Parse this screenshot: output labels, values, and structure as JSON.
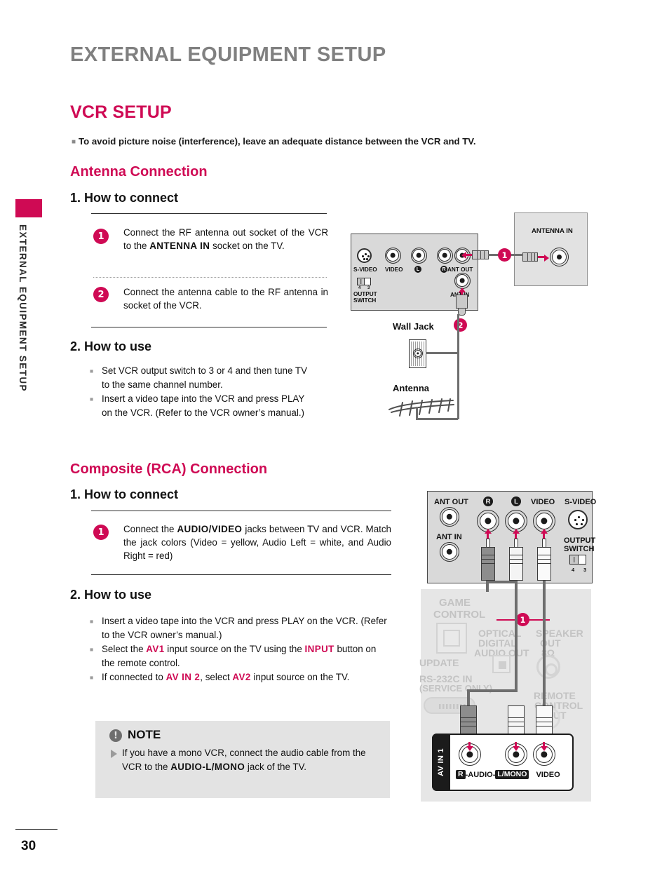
{
  "document": {
    "header_title": "EXTERNAL EQUIPMENT SETUP",
    "side_tab_label": "EXTERNAL EQUIPMENT SETUP",
    "page_number": "30"
  },
  "section": {
    "title": "VCR SETUP",
    "lede": "To avoid picture noise (interference), leave an adequate distance between the VCR and TV."
  },
  "antenna": {
    "heading": "Antenna Connection",
    "connect_heading": "1. How to connect",
    "steps": [
      {
        "number": "1",
        "text_1": "Connect the RF antenna out socket of the VCR to the ",
        "keyword": "ANTENNA IN",
        "text_2": " socket on the TV."
      },
      {
        "number": "2",
        "text_1": "Connect the antenna cable to the RF antenna in socket of the VCR."
      }
    ],
    "use_heading": "2. How to use",
    "use_bullets": [
      "Set VCR output switch to 3 or 4 and then tune TV to the same channel number.",
      "Insert a video tape into the VCR and press PLAY on the VCR. (Refer to the VCR owner’s manual.)"
    ],
    "diagram": {
      "vcr_panel_labels": {
        "s_video": "S-VIDEO",
        "video": "VIDEO",
        "audio_left": "L",
        "audio_right": "R",
        "ant_out": "ANT OUT",
        "ant_in": "ANT IN",
        "output_switch": "OUTPUT SWITCH",
        "switch_pos_4": "4",
        "switch_pos_3": "3"
      },
      "tv_box_label": "ANTENNA IN",
      "wall_jack_label": "Wall Jack",
      "antenna_label": "Antenna",
      "callout_1": "1",
      "callout_2": "2"
    }
  },
  "composite": {
    "heading": "Composite (RCA) Connection",
    "connect_heading": "1. How to connect",
    "step": {
      "number": "1",
      "text_1": "Connect the ",
      "keyword": "AUDIO/VIDEO",
      "text_2": " jacks between TV and VCR. Match the jack colors (Video = yellow, Audio Left = white, and Audio Right = red)"
    },
    "use_heading": "2. How to use",
    "use_bullets": [
      {
        "parts": [
          {
            "t": "Insert a video tape into the VCR and press PLAY on the VCR. (Refer to the VCR owner’s manual.)",
            "style": "normal"
          }
        ]
      },
      {
        "parts": [
          {
            "t": "Select the ",
            "style": "normal"
          },
          {
            "t": "AV1",
            "style": "pink"
          },
          {
            "t": " input source on the TV using the ",
            "style": "normal"
          },
          {
            "t": "INPUT",
            "style": "pink"
          },
          {
            "t": " button on the remote control.",
            "style": "normal"
          }
        ]
      },
      {
        "parts": [
          {
            "t": " If connected to ",
            "style": "normal"
          },
          {
            "t": "AV IN 2",
            "style": "pink"
          },
          {
            "t": ", select ",
            "style": "normal"
          },
          {
            "t": "AV2",
            "style": "pink"
          },
          {
            "t": " input source on the TV.",
            "style": "normal"
          }
        ]
      }
    ],
    "diagram": {
      "vcr_panel_labels": {
        "ant_out": "ANT OUT",
        "ant_in": "ANT IN",
        "audio_right": "R",
        "audio_left": "L",
        "video": "VIDEO",
        "s_video": "S-VIDEO",
        "output_switch_line1": "OUTPUT",
        "output_switch_line2": "SWITCH",
        "switch_pos_4": "4",
        "switch_pos_3": "3"
      },
      "tv_panel_labels": {
        "game_control_line1": "GAME",
        "game_control_line2": "CONTROL",
        "update": "UPDATE",
        "rs232_line1": "RS-232C IN",
        "rs232_line2": "(SERVICE ONLY)",
        "optical_line1": "OPTICAL",
        "optical_line2": "DIGITAL",
        "optical_line3": "AUDIO OUT",
        "speaker_line1": "SPEAKER",
        "speaker_line2": "OUT",
        "speaker_line3": "8Ω",
        "remote_line1": "REMOTE",
        "remote_line2": "CONTROL",
        "remote_line3": "OUT"
      },
      "avin_label": "AV IN 1",
      "avin_jack_r": "R",
      "avin_audio": "-AUDIO-",
      "avin_jack_l": "L/MONO",
      "avin_video": "VIDEO",
      "callout_1": "1"
    }
  },
  "note": {
    "title": "NOTE",
    "text_1": "If you have a mono VCR, connect the audio cable from the VCR to the ",
    "keyword": "AUDIO-L/MONO",
    "text_2": " jack of the TV."
  },
  "colors": {
    "accent_pink": "#cf0a54",
    "header_gray": "#808080",
    "panel_gray": "#d9d9d9",
    "cable_gray": "#6e6e6e",
    "note_bg": "#e3e3e3"
  }
}
